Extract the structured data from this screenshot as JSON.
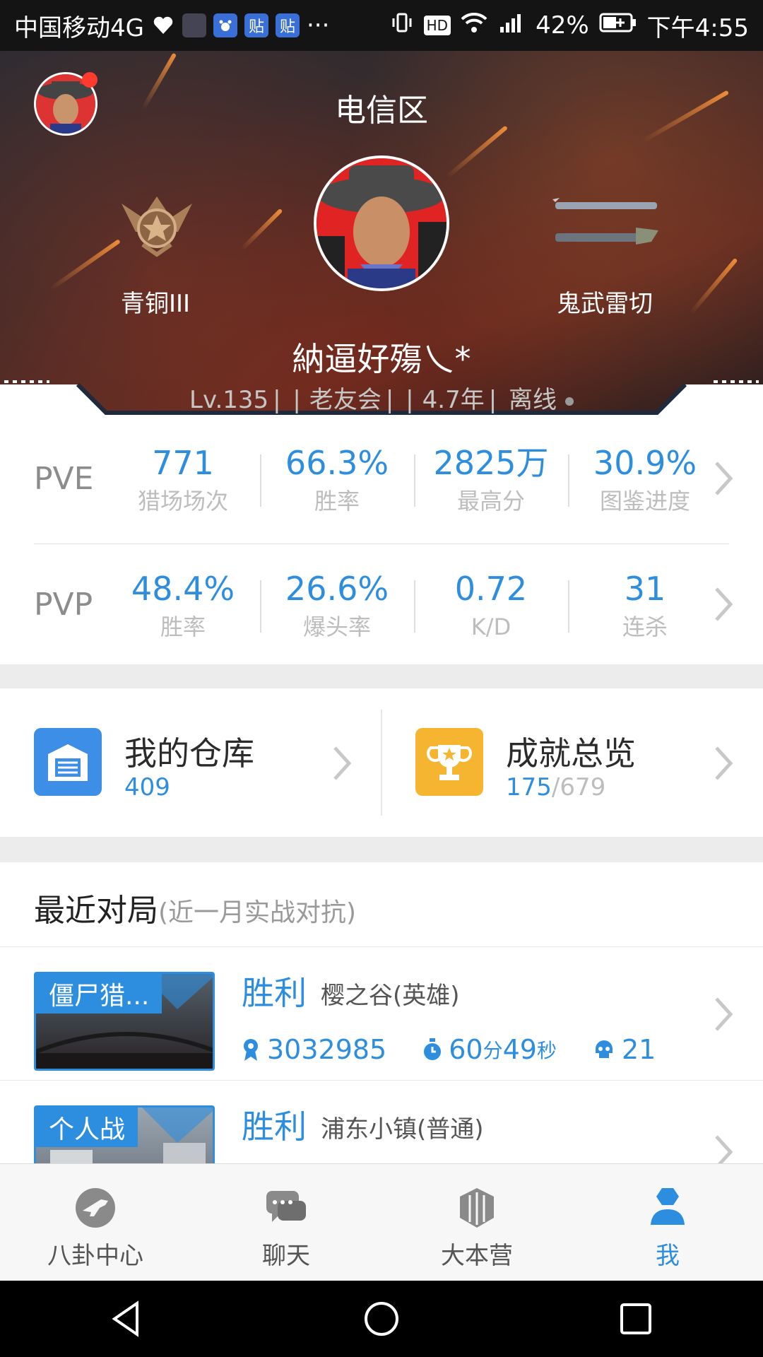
{
  "status_bar": {
    "carrier": "中国移动4G",
    "more": "···",
    "battery": "42%",
    "time": "下午4:55"
  },
  "hero": {
    "server": "电信区",
    "rank_label": "青铜III",
    "weapon_label": "鬼武雷切",
    "player_name": "納逼好殤乀*",
    "level": "Lv.135",
    "club": "老友会",
    "years": "4.7年",
    "online_status": "离线"
  },
  "pve": {
    "label": "PVE",
    "stats": [
      {
        "value": "771",
        "label": "猎场场次"
      },
      {
        "value": "66.3%",
        "label": "胜率"
      },
      {
        "value": "2825万",
        "label": "最高分"
      },
      {
        "value": "30.9%",
        "label": "图鉴进度"
      }
    ]
  },
  "pvp": {
    "label": "PVP",
    "stats": [
      {
        "value": "48.4%",
        "label": "胜率"
      },
      {
        "value": "26.6%",
        "label": "爆头率"
      },
      {
        "value": "0.72",
        "label": "K/D"
      },
      {
        "value": "31",
        "label": "连杀"
      }
    ]
  },
  "warehouse": {
    "title": "我的仓库",
    "count": "409"
  },
  "achievements": {
    "title": "成就总览",
    "done": "175",
    "total": "/679"
  },
  "recent": {
    "title": "最近对局",
    "subtitle": "(近一月实战对抗)",
    "matches": [
      {
        "tag": "僵尸猎...",
        "result": "胜利",
        "map": "樱之谷(英雄)",
        "score": "3032985",
        "min": "60",
        "min_unit": "分",
        "sec": "49",
        "sec_unit": "秒",
        "kills": "21"
      },
      {
        "tag": "个人战",
        "result": "胜利",
        "map": "浦东小镇(普通)"
      }
    ]
  },
  "tabs": [
    {
      "label": "八卦中心",
      "icon": "gun-circle-icon"
    },
    {
      "label": "聊天",
      "icon": "chat-icon"
    },
    {
      "label": "大本营",
      "icon": "hexagon-icon"
    },
    {
      "label": "我",
      "icon": "user-icon"
    }
  ],
  "colors": {
    "accent": "#2d8ee0",
    "gold": "#f5b531",
    "warehouse": "#3d8ee6"
  }
}
